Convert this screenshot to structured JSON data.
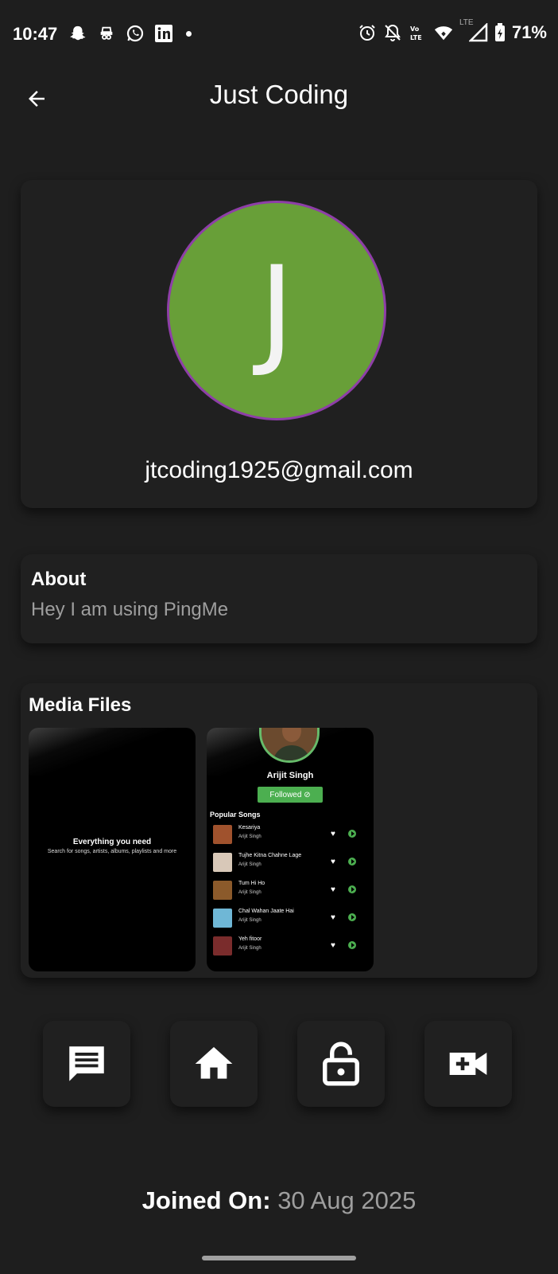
{
  "status_bar": {
    "time": "10:47",
    "battery": "71%",
    "left_icons": [
      "snapchat-icon",
      "incognito-icon",
      "whatsapp-icon",
      "linkedin-icon",
      "dot-icon"
    ],
    "right_icons": [
      "alarm-icon",
      "notifications-off-icon",
      "volte-icon",
      "wifi-icon",
      "signal-icon",
      "battery-icon"
    ],
    "network_label": "LTE"
  },
  "app_bar": {
    "title": "Just Coding",
    "back_icon": "arrow-back-icon"
  },
  "profile": {
    "avatar_letter": "J",
    "avatar_color": "#689f38",
    "avatar_border_color": "#8e3ea8",
    "email": "jtcoding1925@gmail.com"
  },
  "about": {
    "title": "About",
    "text": "Hey I am using PingMe"
  },
  "media": {
    "title": "Media Files",
    "items": [
      {
        "title": "Everything you need",
        "subtitle": "Search for songs, artists, albums, playlists and more"
      },
      {
        "artist": "Arijit Singh",
        "follow_label": "Followed ⊘",
        "section_title": "Popular Songs",
        "songs": [
          {
            "name": "Kesariya",
            "artist": "Arijit Singh",
            "art_color": "#a0522d"
          },
          {
            "name": "Tujhe Kitna Chahne Lage",
            "artist": "Arijit Singh",
            "art_color": "#d8c8b8"
          },
          {
            "name": "Tum Hi Ho",
            "artist": "Arijit Singh",
            "art_color": "#8b5a2b"
          },
          {
            "name": "Chal Wahan Jaate Hai",
            "artist": "Arijit Singh",
            "art_color": "#6fb7d6"
          },
          {
            "name": "Yeh fitoor",
            "artist": "Arijit Singh",
            "art_color": "#7a2c2c"
          }
        ]
      }
    ]
  },
  "actions": [
    {
      "icon": "chat-icon"
    },
    {
      "icon": "home-icon"
    },
    {
      "icon": "lock-open-icon"
    },
    {
      "icon": "video-call-add-icon"
    }
  ],
  "joined": {
    "label": "Joined On:",
    "date": "30 Aug 2025"
  },
  "colors": {
    "background": "#1e1e1e",
    "card": "#202020",
    "accent_green": "#4caf50",
    "secondary_text": "#9e9e9e"
  }
}
